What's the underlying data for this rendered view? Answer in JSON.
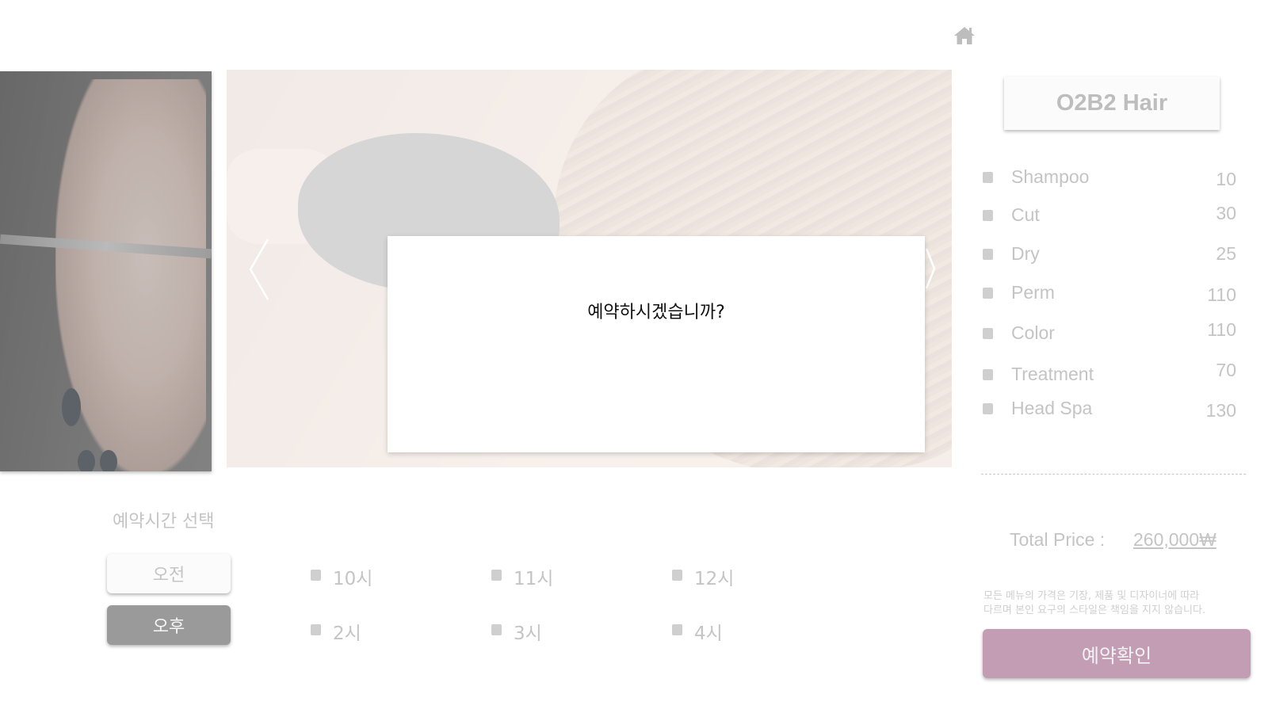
{
  "header": {
    "home_icon": "home-icon"
  },
  "gallery": {
    "prev_icon": "chevron-left-icon",
    "next_icon": "chevron-right-icon"
  },
  "dialog": {
    "message": "예약하시겠습니까?"
  },
  "salon": {
    "name": "O2B2 Hair",
    "menu": [
      {
        "name": "Shampoo",
        "price": "10"
      },
      {
        "name": "Cut",
        "price": "30"
      },
      {
        "name": "Dry",
        "price": "25"
      },
      {
        "name": "Perm",
        "price": "110"
      },
      {
        "name": "Color",
        "price": "110"
      },
      {
        "name": "Treatment",
        "price": "70"
      },
      {
        "name": "Head Spa",
        "price": "130"
      }
    ],
    "total_label": "Total Price :",
    "total_value": "260,000₩",
    "disclaimer_line1": "모든 메뉴의 가격은 기장, 제품 및 디자이너에 따라",
    "disclaimer_line2": "다르며 본인 요구의 스타일은 책임을 지지 않습니다.",
    "confirm_label": "예약확인"
  },
  "booking": {
    "title": "예약시간 선택",
    "am_label": "오전",
    "pm_label": "오후",
    "selected_period": "오후",
    "slots": [
      "10시",
      "11시",
      "12시",
      "2시",
      "3시",
      "4시"
    ]
  },
  "colors": {
    "accent": "#c29db4",
    "selected_period": "#9a9a9a",
    "muted_text": "#c4c4c4"
  }
}
